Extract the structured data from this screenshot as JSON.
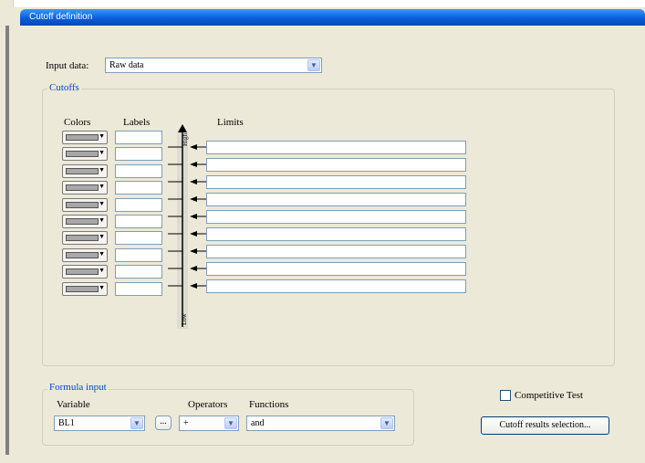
{
  "window": {
    "title": "Cutoff definition"
  },
  "input": {
    "label": "Input data:",
    "value": "Raw data"
  },
  "cutoffs": {
    "group_label": "Cutoffs",
    "headers": {
      "colors": "Colors",
      "labels": "Labels",
      "limits": "Limits"
    },
    "scale": {
      "high": "High",
      "low": "Low"
    },
    "color_rows": 10,
    "limit_rows": 9
  },
  "formula": {
    "group_label": "Formula input",
    "variable": {
      "label": "Variable",
      "value": "BL1"
    },
    "ellipsis": "...",
    "operators": {
      "label": "Operators",
      "value": "+"
    },
    "functions": {
      "label": "Functions",
      "value": "and"
    }
  },
  "competitive": {
    "label": "Competitive Test",
    "checked": false
  },
  "results_button": "Cutoff results selection..."
}
